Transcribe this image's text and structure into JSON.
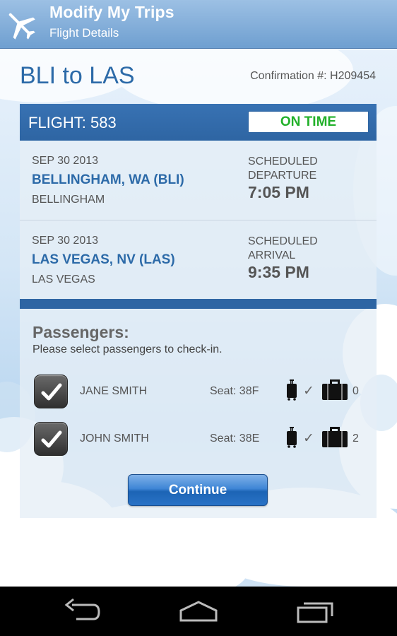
{
  "actionbar": {
    "title": "Modify My Trips",
    "subtitle": "Flight Details",
    "icon": "airplane-icon"
  },
  "trip": {
    "route": "BLI to LAS",
    "confirmation": "Confirmation #: H209454"
  },
  "flight": {
    "label": "FLIGHT: 583",
    "status": "ON TIME",
    "segments": [
      {
        "date": "SEP 30 2013",
        "airport": "BELLINGHAM, WA (BLI)",
        "city": "BELLINGHAM",
        "label": "SCHEDULED DEPARTURE",
        "time": "7:05 PM"
      },
      {
        "date": "SEP 30 2013",
        "airport": "LAS VEGAS, NV (LAS)",
        "city": "LAS VEGAS",
        "label": "SCHEDULED ARRIVAL",
        "time": "9:35 PM"
      }
    ]
  },
  "passengers": {
    "title": "Passengers:",
    "subtitle": "Please select passengers to check-in.",
    "list": [
      {
        "name": "JANE SMITH",
        "seat": "Seat: 38F",
        "checked": true,
        "bags": "0"
      },
      {
        "name": "JOHN SMITH",
        "seat": "Seat: 38E",
        "checked": true,
        "bags": "2"
      }
    ]
  },
  "continue_label": "Continue",
  "colors": {
    "brand_blue": "#2e65a3",
    "link_blue": "#2c6aa8",
    "status_green": "#22b02a"
  }
}
